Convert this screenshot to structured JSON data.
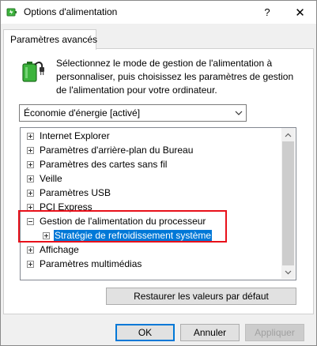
{
  "window": {
    "title": "Options d'alimentation",
    "help_symbol": "?",
    "close_symbol": "✕"
  },
  "tab": {
    "label": "Paramètres avancés"
  },
  "description": {
    "line1": "Sélectionnez le mode de gestion de l'alimentation à",
    "line2": "personnaliser, puis choisissez les paramètres de gestion",
    "line3": "de l'alimentation pour votre ordinateur."
  },
  "plan_select": {
    "selected": "Économie d'énergie [activé]"
  },
  "tree": {
    "items": [
      {
        "label": "Internet Explorer",
        "expanded": false,
        "level": 0
      },
      {
        "label": "Paramètres d'arrière-plan du Bureau",
        "expanded": false,
        "level": 0
      },
      {
        "label": "Paramètres des cartes sans fil",
        "expanded": false,
        "level": 0
      },
      {
        "label": "Veille",
        "expanded": false,
        "level": 0
      },
      {
        "label": "Paramètres USB",
        "expanded": false,
        "level": 0
      },
      {
        "label": "PCI Express",
        "expanded": false,
        "level": 0
      },
      {
        "label": "Gestion de l'alimentation du processeur",
        "expanded": true,
        "level": 0
      },
      {
        "label": "Stratégie de refroidissement système",
        "expanded": false,
        "level": 1,
        "selected": true
      },
      {
        "label": "Affichage",
        "expanded": false,
        "level": 0
      },
      {
        "label": "Paramètres multimédias",
        "expanded": false,
        "level": 0
      }
    ]
  },
  "buttons": {
    "restore": "Restaurer les valeurs par défaut",
    "ok": "OK",
    "cancel": "Annuler",
    "apply": "Appliquer"
  },
  "colors": {
    "selection": "#0078d7",
    "highlight_box": "#e8101a",
    "battery_green": "#3cb43c"
  }
}
